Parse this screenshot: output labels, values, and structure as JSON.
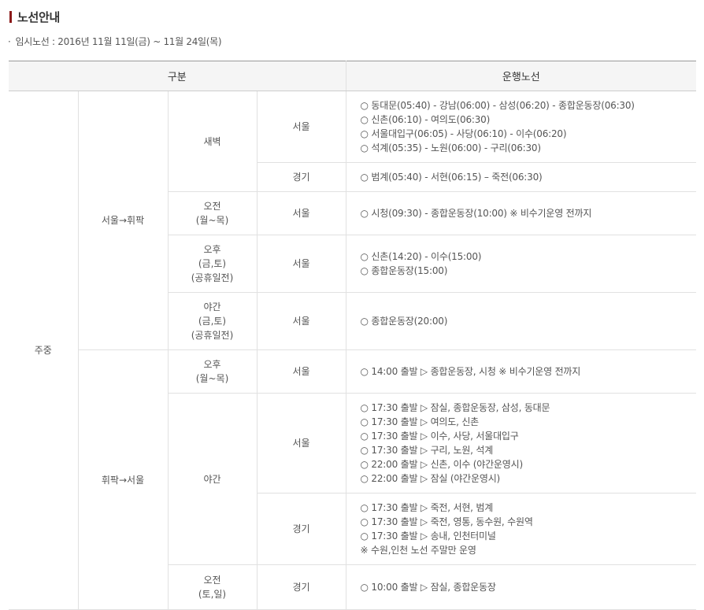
{
  "title": "노선안내",
  "period": "임시노선 : 2016년 11월 11일(금) ~ 11월 24일(목)",
  "colors": {
    "accent": "#8b1a1a",
    "header_bg": "#f5f5f5",
    "border": "#e1e1e1"
  },
  "table": {
    "headers": {
      "category": "구분",
      "route": "운행노선"
    },
    "group": "주중",
    "directions": [
      "서울→휘팍",
      "휘팍→서울"
    ],
    "times": {
      "dawn": "새벽",
      "am_weekday": [
        "오전",
        "(월~목)"
      ],
      "pm_fri": [
        "오후",
        "(금,토)",
        "(공휴일전)"
      ],
      "night_fri": [
        "야간",
        "(금,토)",
        "(공휴일전)"
      ],
      "pm_weekday": [
        "오후",
        "(월~목)"
      ],
      "night": "야간",
      "am_weekend": [
        "오전",
        "(토,일)"
      ]
    },
    "regions": {
      "seoul": "서울",
      "gyeonggi": "경기"
    },
    "routes": {
      "r1": [
        "○ 동대문(05:40) - 강남(06:00) - 삼성(06:20) - 종합운동장(06:30)",
        "○ 신촌(06:10) - 여의도(06:30)",
        "○ 서울대입구(06:05) - 사당(06:10) - 이수(06:20)",
        "○ 석계(05:35) - 노원(06:00) - 구리(06:30)"
      ],
      "r2": [
        "○ 범계(05:40) - 서현(06:15) – 죽전(06:30)"
      ],
      "r3": [
        "○ 시청(09:30) - 종합운동장(10:00) ※ 비수기운영 전까지"
      ],
      "r4": [
        "○ 신촌(14:20) - 이수(15:00)",
        "○ 종합운동장(15:00)"
      ],
      "r5": [
        "○ 종합운동장(20:00)"
      ],
      "r6": [
        "○ 14:00 출발 ▷ 종합운동장, 시청 ※ 비수기운영 전까지"
      ],
      "r7": [
        "○ 17:30 출발 ▷ 잠실, 종합운동장, 삼성, 동대문",
        "○ 17:30 출발 ▷ 여의도, 신촌",
        "○ 17:30 출발 ▷ 이수, 사당, 서울대입구",
        "○ 17:30 출발 ▷ 구리, 노원, 석계",
        "○ 22:00 출발 ▷ 신촌, 이수 (야간운영시)",
        "○ 22:00 출발 ▷ 잠실 (야간운영시)"
      ],
      "r8": [
        "○ 17:30 출발 ▷ 죽전, 서현, 범계",
        "○ 17:30 출발 ▷ 죽전, 영통, 동수원, 수원역",
        "○ 17:30 출발 ▷ 송내, 인천터미널",
        "※ 수원,인천 노선 주말만 운영"
      ],
      "r9": [
        "○ 10:00 출발 ▷ 잠실, 종합운동장"
      ]
    }
  }
}
